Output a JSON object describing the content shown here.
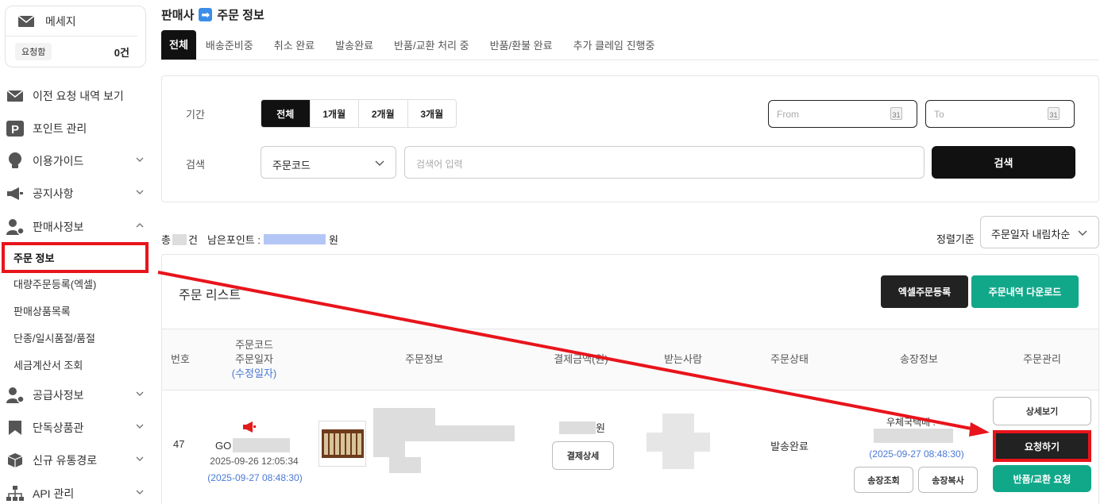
{
  "sidebar": {
    "message": {
      "title": "메세지",
      "badge": "요청함",
      "count": "0건"
    },
    "items": [
      {
        "label": "이전 요청 내역 보기",
        "icon": "envelope-icon"
      },
      {
        "label": "포인트 관리",
        "icon": "point-p-icon"
      },
      {
        "label": "이용가이드",
        "icon": "lightbulb-icon"
      },
      {
        "label": "공지사항",
        "icon": "megaphone-icon"
      },
      {
        "label": "판매사정보",
        "icon": "user-gear-icon"
      },
      {
        "label": "공급사정보",
        "icon": "user-clock-icon"
      },
      {
        "label": "단독상품관",
        "icon": "bookmark-icon"
      },
      {
        "label": "신규 유통경로",
        "icon": "box-icon"
      },
      {
        "label": "API 관리",
        "icon": "sitemap-icon"
      }
    ],
    "subitems": [
      "주문 정보",
      "대량주문등록(엑셀)",
      "판매상품목록",
      "단종/일시품절/품절",
      "세금계산서 조회"
    ]
  },
  "breadcrumb": {
    "parent": "판매사",
    "current": "주문 정보"
  },
  "tabs": [
    "전체",
    "배송준비중",
    "취소 완료",
    "발송완료",
    "반품/교환 처리 중",
    "반품/환불 완료",
    "추가 클레임 진행중"
  ],
  "filter": {
    "period_label": "기간",
    "periods": [
      "전체",
      "1개월",
      "2개월",
      "3개월"
    ],
    "from_placeholder": "From",
    "to_placeholder": "To",
    "calendar_day": "31",
    "search_label": "검색",
    "search_type": "주문코드",
    "search_placeholder": "검색어 입력",
    "search_button": "검색"
  },
  "summary": {
    "total_prefix": "총",
    "total_suffix": "건",
    "points_label": "남은포인트 :",
    "points_suffix": "원"
  },
  "sort": {
    "label": "정렬기준",
    "value": "주문일자 내림차순"
  },
  "list": {
    "title": "주문 리스트",
    "excel_button": "엑셀주문등록",
    "download_button": "주문내역 다운로드",
    "headers": {
      "no": "번호",
      "code1": "주문코드",
      "code2": "주문일자",
      "code3": "(수정일자)",
      "info": "주문정보",
      "amount": "결제금액(원)",
      "receiver": "받는사람",
      "status": "주문상태",
      "invoice": "송장정보",
      "manage": "주문관리"
    },
    "row": {
      "no": "47",
      "code_prefix": "GO",
      "order_date": "2025-09-26 12:05:34",
      "modified_date": "(2025-09-27 08:48:30)",
      "amount_suffix": "원",
      "pay_detail": "결제상세",
      "status": "발송완료",
      "carrier_prefix": "우체국택배 :",
      "invoice_date": "(2025-09-27 08:48:30)",
      "invoice_lookup": "송장조회",
      "invoice_copy": "송장복사",
      "detail_button": "상세보기",
      "request_button": "요청하기",
      "return_button": "반품/교환 요청"
    }
  },
  "colors": {
    "accent_red": "#e8141b",
    "teal": "#11a88a",
    "link_blue": "#4a78d6"
  }
}
